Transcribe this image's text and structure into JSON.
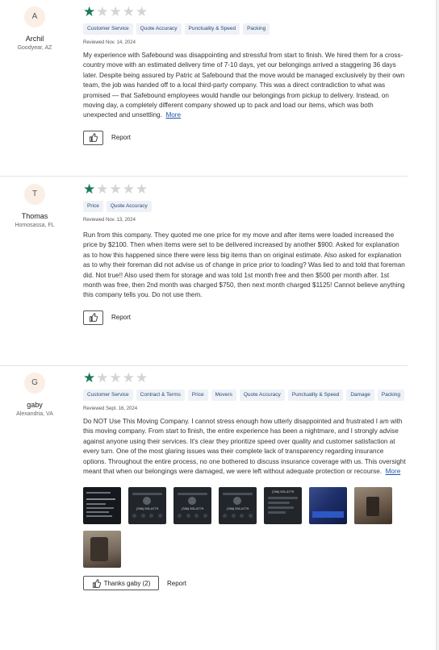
{
  "reviews": [
    {
      "initial": "A",
      "name": "Archil",
      "location": "Goodyear, AZ",
      "rating": 1,
      "tags": [
        "Customer Service",
        "Quote Accuracy",
        "Punctuality & Speed",
        "Packing"
      ],
      "date": "Reviewed Nov. 14, 2024",
      "text": "My experience with Safebound was disappointing and stressful from start to finish. We hired them for a cross-country move with an estimated delivery time of 7-10 days, yet our belongings arrived a staggering 36 days later. Despite being assured by Patric at Safebound that the move would be managed exclusively by their own team, the job was handed off to a local third-party company. This was a direct contradiction to what was promised — that Safebound employees would handle our belongings from pickup to delivery. Instead, on moving day, a completely different company showed up to pack and load our items, which was both unexpected and unsettling.",
      "more": "More",
      "report": "Report"
    },
    {
      "initial": "T",
      "name": "Thomas",
      "location": "Homosassa, FL",
      "rating": 1,
      "tags": [
        "Price",
        "Quote Accuracy"
      ],
      "date": "Reviewed Nov. 13, 2024",
      "text": "Run from this company. They quoted me one price for my move and after items were loaded increased the price by $2100. Then when items were set to be delivered increased by another $900. Asked for explanation as to how this happened since there were less big items than on original estimate. Also asked for explanation as to why their foreman did not advise us of change in price prior to loading? Was lied to and told that foreman did. Not true!! Also used them for storage and was told 1st month free and then $500 per month after. 1st month was free, then 2nd month was charged $750, then next month charged $1125! Cannot believe anything this company tells you. Do not use them.",
      "report": "Report"
    },
    {
      "initial": "G",
      "name": "gaby",
      "location": "Alexandria, VA",
      "rating": 1,
      "tags": [
        "Customer Service",
        "Contract & Terms",
        "Price",
        "Movers",
        "Quote Accuracy",
        "Punctuality & Speed",
        "Damage",
        "Packing"
      ],
      "date": "Reviewed Sept. 16, 2024",
      "text": "Do NOT Use This Moving Company. I cannot stress enough how utterly disappointed and frustrated I am with this moving company. From start to finish, the entire experience has been a nightmare, and I strongly advise against anyone using their services. It's clear they prioritize speed over quality and customer satisfaction at every turn. One of the most glaring issues was their complete lack of transparency regarding insurance options. Throughout the entire process, no one bothered to discuss insurance coverage with us. This oversight meant that when our belongings were damaged, we were left without adequate protection or recourse.",
      "more": "More",
      "photo_numbers": [
        "(786) 931-6779",
        "(786) 931-6779",
        "(786) 931-6779",
        "(786) 931-6779"
      ],
      "thanks": "Thanks gaby (2)",
      "report": "Report"
    }
  ],
  "colors": {
    "star_on": "#1a7a56",
    "star_off": "#d4d4d4",
    "link": "#1c57a8",
    "tag_bg": "#eef1f6"
  }
}
